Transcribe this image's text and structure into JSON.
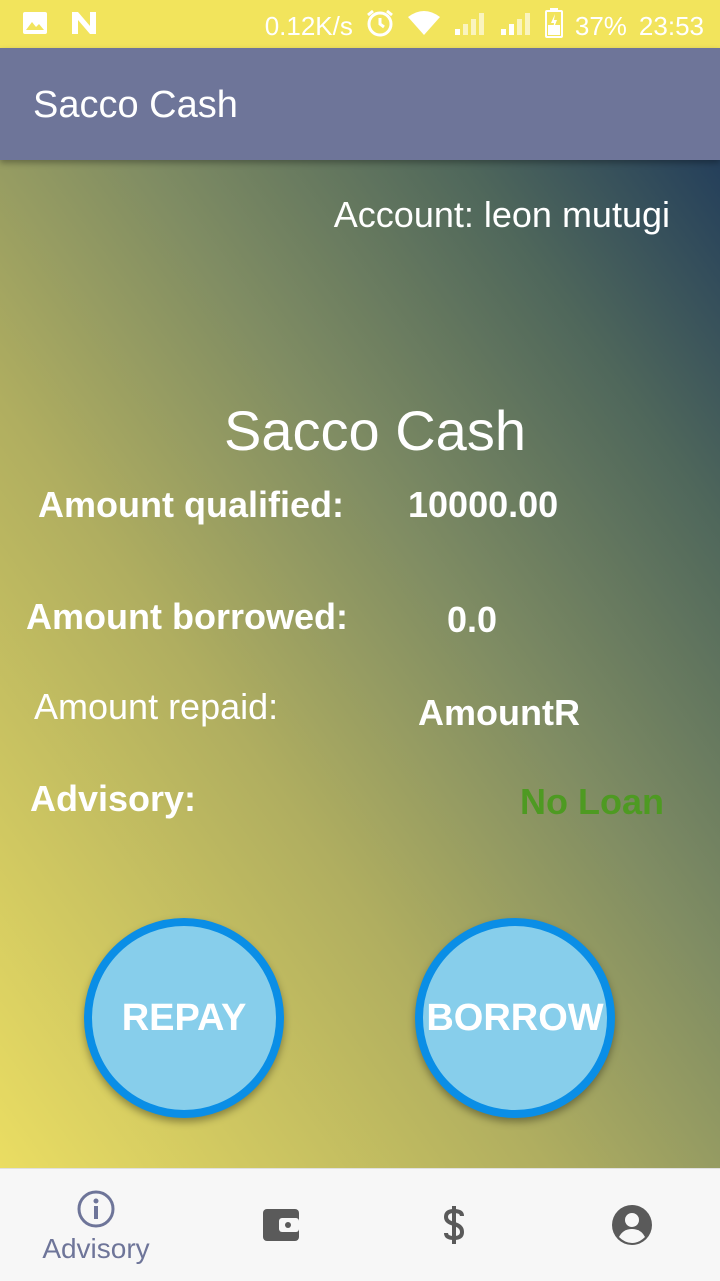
{
  "status_bar": {
    "network_speed": "0.12K/s",
    "battery_percent": "37%",
    "time": "23:53",
    "icons": [
      "image-icon",
      "n-icon",
      "alarm-icon",
      "wifi-icon",
      "signal-icon",
      "signal-icon",
      "battery-icon"
    ]
  },
  "app_bar": {
    "title": "Sacco Cash"
  },
  "account": {
    "label": "Account:",
    "name": "leon mutugi"
  },
  "hero": {
    "title": "Sacco Cash"
  },
  "rows": {
    "qualified": {
      "label": "Amount qualified:",
      "value": "10000.00"
    },
    "borrowed": {
      "label": "Amount borrowed:",
      "value": "0.0"
    },
    "repaid": {
      "label": "Amount repaid:",
      "value": "AmountR"
    },
    "advisory": {
      "label": "Advisory:",
      "value": "No Loan"
    }
  },
  "buttons": {
    "repay": "REPAY",
    "borrow": "BORROW"
  },
  "bottom_nav": {
    "items": [
      {
        "icon": "info-icon",
        "label": "Advisory",
        "active": true
      },
      {
        "icon": "wallet-icon",
        "label": ""
      },
      {
        "icon": "dollar-icon",
        "label": ""
      },
      {
        "icon": "account-circle-icon",
        "label": ""
      }
    ]
  },
  "colors": {
    "status_bar": "#f2e45c",
    "app_bar": "#6e7599",
    "advisory_value": "#4e9a22",
    "button_fill": "#87ceeb",
    "button_border": "#0a8ee6",
    "nav_active": "#6e7599",
    "nav_inactive": "#5a5a5a"
  }
}
